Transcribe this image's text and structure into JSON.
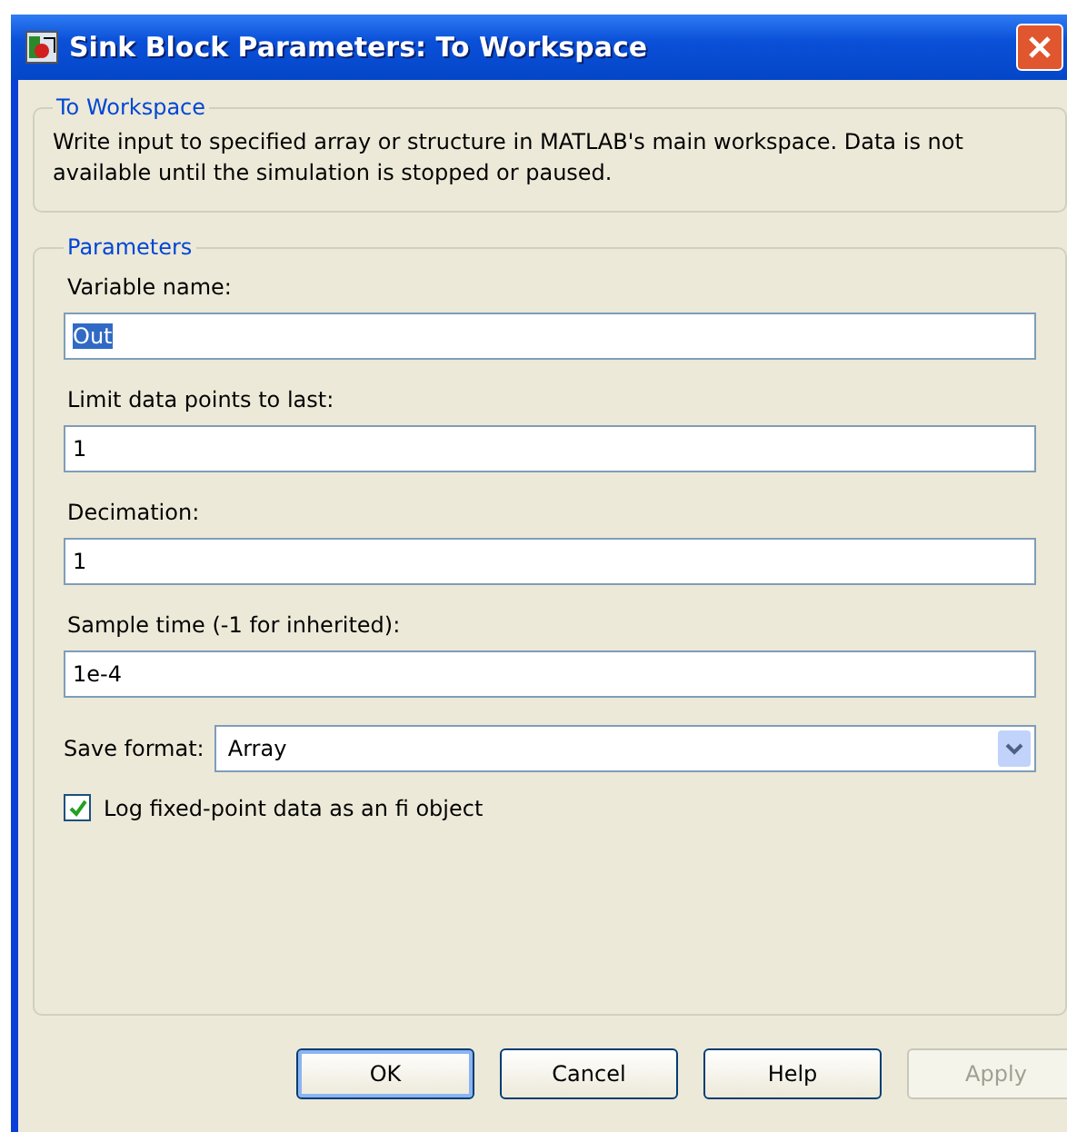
{
  "window": {
    "title": "Sink Block Parameters: To Workspace"
  },
  "description_group": {
    "title": "To Workspace",
    "text": "Write input to specified array or structure in MATLAB's main workspace. Data is not available until the simulation is stopped or paused."
  },
  "parameters_group": {
    "title": "Parameters",
    "fields": [
      {
        "label": "Variable name:",
        "value": "Out",
        "highlighted": true
      },
      {
        "label": "Limit data points to last:",
        "value": "1",
        "highlighted": false
      },
      {
        "label": "Decimation:",
        "value": "1",
        "highlighted": false
      },
      {
        "label": "Sample time (-1 for inherited):",
        "value": "1e-4",
        "highlighted": false
      }
    ],
    "save_format": {
      "label": "Save format:",
      "value": "Array"
    },
    "checkbox": {
      "label": "Log fixed-point data as an fi object",
      "checked": true
    }
  },
  "buttons": [
    {
      "label": "OK",
      "disabled": false,
      "default": true
    },
    {
      "label": "Cancel",
      "disabled": false,
      "default": false
    },
    {
      "label": "Help",
      "disabled": false,
      "default": false
    },
    {
      "label": "Apply",
      "disabled": true,
      "default": false
    }
  ]
}
